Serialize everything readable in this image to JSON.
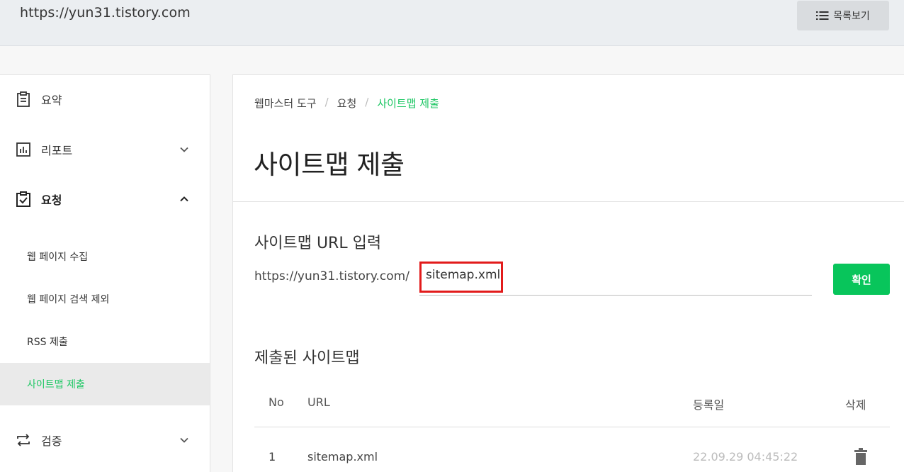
{
  "header": {
    "site_url": "https://yun31.tistory.com",
    "list_button": {
      "label": "목록보기",
      "icon": "list-icon"
    }
  },
  "sidebar": {
    "items": [
      {
        "label": "요약",
        "icon": "clipboard-icon"
      },
      {
        "label": "리포트",
        "icon": "bar-chart-icon",
        "chevron": "down"
      },
      {
        "label": "요청",
        "icon": "clipboard-check-icon",
        "chevron": "up",
        "expanded": true
      },
      {
        "label": "검증",
        "icon": "repeat-icon",
        "chevron": "down"
      }
    ],
    "subitems": [
      {
        "label": "웹 페이지 수집"
      },
      {
        "label": "웹 페이지 검색 제외"
      },
      {
        "label": "RSS 제출"
      },
      {
        "label": "사이트맵 제출",
        "active": true
      }
    ]
  },
  "breadcrumb": [
    "웹마스터 도구",
    "요청",
    "사이트맵 제출"
  ],
  "page_title": "사이트맵 제출",
  "sitemap_input": {
    "section_title": "사이트맵 URL 입력",
    "prefix": "https://yun31.tistory.com/",
    "value": "sitemap.xml",
    "confirm_label": "확인"
  },
  "submitted": {
    "section_title": "제출된 사이트맵",
    "columns": [
      "No",
      "URL",
      "등록일",
      "삭제"
    ],
    "rows": [
      {
        "no": "1",
        "url": "sitemap.xml",
        "date": "22.09.29 04:45:22",
        "delete_icon": "trash-icon"
      }
    ]
  },
  "colors": {
    "accent": "#1ec764",
    "button": "#08c55b",
    "highlight_border": "#e21b1b"
  }
}
